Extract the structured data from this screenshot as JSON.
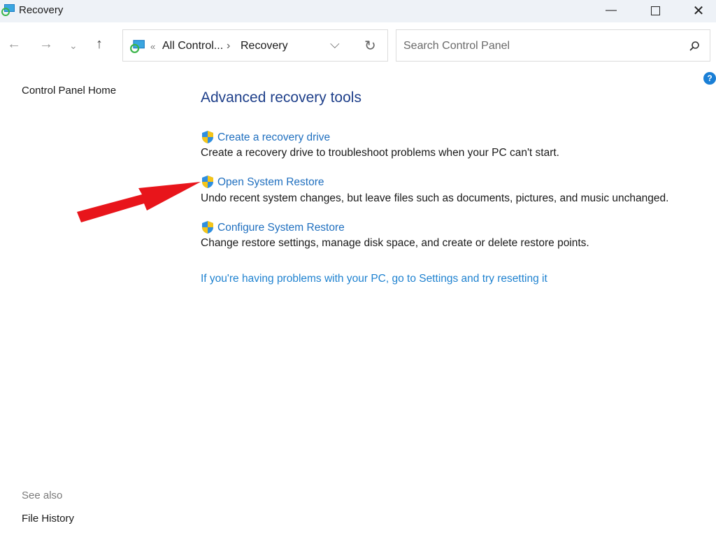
{
  "window": {
    "title": "Recovery",
    "app_icon": "recovery-icon",
    "controls": [
      "minimize",
      "maximize",
      "close"
    ]
  },
  "nav": {
    "back": "back-arrow-icon",
    "forward": "forward-arrow-icon",
    "recent": "chevron-down-icon",
    "up": "up-arrow-icon"
  },
  "address": {
    "overflow": "«",
    "crumbs": [
      "All Control...",
      "Recovery"
    ],
    "separator": "›"
  },
  "search": {
    "placeholder": "Search Control Panel"
  },
  "sidebar": {
    "home": "Control Panel Home",
    "see_also": "See also",
    "items": [
      "File History"
    ]
  },
  "main": {
    "heading": "Advanced recovery tools",
    "tools": [
      {
        "label": "Create a recovery drive",
        "description": "Create a recovery drive to troubleshoot problems when your PC can't start."
      },
      {
        "label": "Open System Restore",
        "description": "Undo recent system changes, but leave files such as documents, pictures, and music unchanged."
      },
      {
        "label": "Configure System Restore",
        "description": "Change restore settings, manage disk space, and create or delete restore points."
      }
    ],
    "reset_link": "If you're having problems with your PC, go to Settings and try resetting it"
  },
  "colors": {
    "link": "#1f6fbf",
    "heading": "#1e3f8a",
    "annotation_arrow": "#e8151b"
  }
}
